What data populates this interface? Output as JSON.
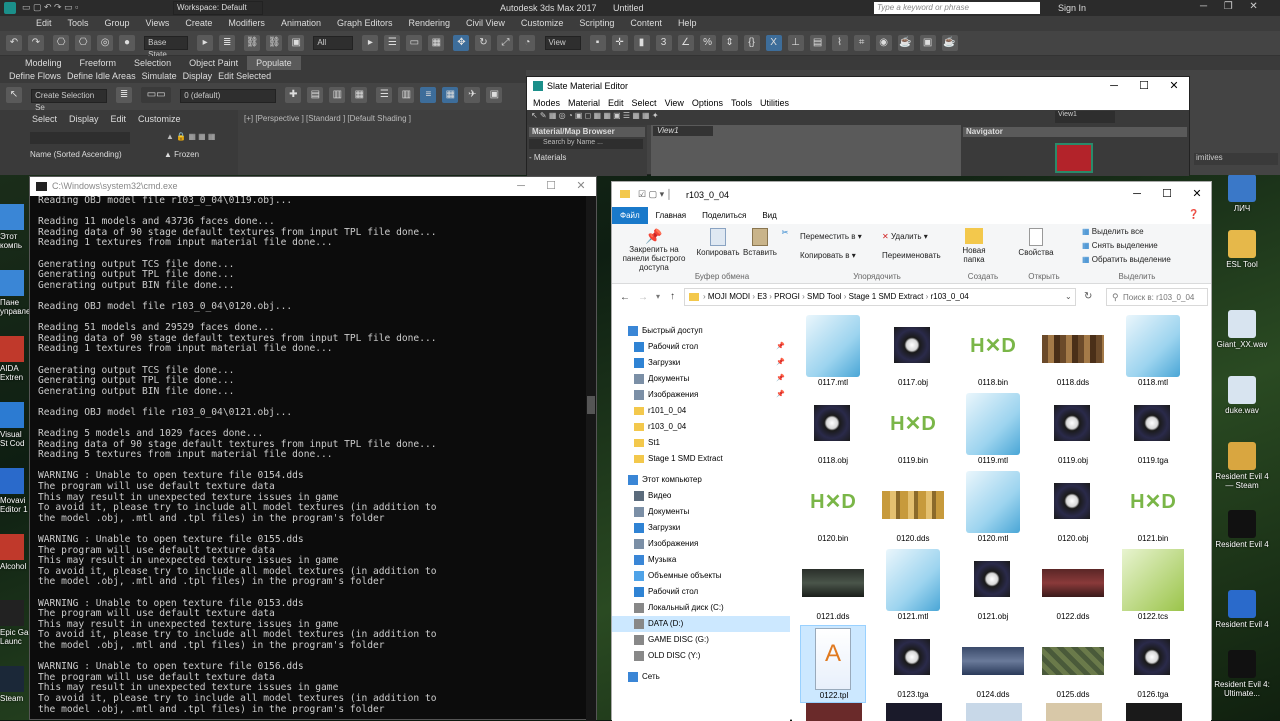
{
  "max": {
    "title": "Autodesk 3ds Max 2017",
    "file": "Untitled",
    "workspace": "Workspace: Default",
    "search_placeholder": "Type a keyword or phrase",
    "sign_in": "Sign In",
    "menu": [
      "Edit",
      "Tools",
      "Group",
      "Views",
      "Create",
      "Modifiers",
      "Animation",
      "Graph Editors",
      "Rendering",
      "Civil View",
      "Customize",
      "Scripting",
      "Content",
      "Help"
    ],
    "base_state": "Base State",
    "filter_all": "All",
    "view_combo": "View",
    "ribbon_tabs": [
      "Modeling",
      "Freeform",
      "Selection",
      "Object Paint",
      "Populate"
    ],
    "ribbon_items": [
      "Define Flows",
      "Define Idle Areas",
      "Simulate",
      "Display",
      "Edit Selected"
    ],
    "selection_set": "Create Selection Se",
    "layer": "0 (default)",
    "scene_tabs": [
      "Select",
      "Display",
      "Edit",
      "Customize"
    ],
    "scene_col_name": "Name (Sorted Ascending)",
    "scene_col_frozen": "▲ Frozen",
    "viewport_label": "[+] [Perspective ] [Standard ] [Default Shading ]",
    "right_panel_text": "imitives"
  },
  "slate": {
    "title": "Slate Material Editor",
    "menu": [
      "Modes",
      "Material",
      "Edit",
      "Select",
      "View",
      "Options",
      "Tools",
      "Utilities"
    ],
    "browser_title": "Material/Map Browser",
    "search_placeholder": "Search by Name ...",
    "materials_label": "- Materials",
    "view_tab": "View1",
    "view_combo": "View1",
    "navigator_title": "Navigator"
  },
  "cmd": {
    "title": "C:\\Windows\\system32\\cmd.exe",
    "lines": [
      "Reading OBJ model file r103_0_04\\0119.obj...",
      "",
      "Reading 11 models and 43736 faces done...",
      "Reading data of 90 stage default textures from input TPL file done...",
      "Reading 1 textures from input material file done...",
      "",
      "Generating output TCS file done...",
      "Generating output TPL file done...",
      "Generating output BIN file done...",
      "",
      "Reading OBJ model file r103_0_04\\0120.obj...",
      "",
      "Reading 51 models and 29529 faces done...",
      "Reading data of 90 stage default textures from input TPL file done...",
      "Reading 1 textures from input material file done...",
      "",
      "Generating output TCS file done...",
      "Generating output TPL file done...",
      "Generating output BIN file done...",
      "",
      "Reading OBJ model file r103_0_04\\0121.obj...",
      "",
      "Reading 5 models and 1029 faces done...",
      "Reading data of 90 stage default textures from input TPL file done...",
      "Reading 5 textures from input material file done...",
      "",
      "WARNING : Unable to open texture file 0154.dds",
      "The program will use default texture data",
      "This may result in unexpected texture issues in game",
      "To avoid it, please try to include all model textures (in addition to",
      "the model .obj, .mtl and .tpl files) in the program's folder",
      "",
      "WARNING : Unable to open texture file 0155.dds",
      "The program will use default texture data",
      "This may result in unexpected texture issues in game",
      "To avoid it, please try to include all model textures (in addition to",
      "the model .obj, .mtl and .tpl files) in the program's folder",
      "",
      "WARNING : Unable to open texture file 0153.dds",
      "The program will use default texture data",
      "This may result in unexpected texture issues in game",
      "To avoid it, please try to include all model textures (in addition to",
      "the model .obj, .mtl and .tpl files) in the program's folder",
      "",
      "WARNING : Unable to open texture file 0156.dds",
      "The program will use default texture data",
      "This may result in unexpected texture issues in game",
      "To avoid it, please try to include all model textures (in addition to",
      "the model .obj, .mtl and .tpl files) in the program's folder"
    ]
  },
  "explorer": {
    "title": "r103_0_04",
    "tabs": [
      "Файл",
      "Главная",
      "Поделиться",
      "Вид"
    ],
    "ribbon": {
      "pin": "Закрепить на панели быстрого доступа",
      "copy": "Копировать",
      "paste": "Вставить",
      "clipboard": "Буфер обмена",
      "move_to": "Переместить в ▾",
      "copy_to": "Копировать в ▾",
      "delete": "Удалить ▾",
      "rename": "Переименовать",
      "organize": "Упорядочить",
      "new_folder": "Новая папка",
      "create": "Создать",
      "properties": "Свойства",
      "open": "Открыть",
      "select_all": "Выделить все",
      "select_none": "Снять выделение",
      "invert": "Обратить выделение",
      "select": "Выделить"
    },
    "breadcrumb": [
      "MOJI MODI",
      "E3",
      "PROGI",
      "SMD Tool",
      "Stage 1 SMD Extract",
      "r103_0_04"
    ],
    "search_placeholder": "Поиск в: r103_0_04",
    "nav": [
      {
        "label": "Быстрый доступ",
        "indent": 0,
        "icon": "star-icon",
        "color": "#3a86d6"
      },
      {
        "label": "Рабочий стол",
        "indent": 1,
        "icon": "desktop-icon",
        "color": "#2f83d4"
      },
      {
        "label": "Загрузки",
        "indent": 1,
        "icon": "download-icon",
        "color": "#2f83d4"
      },
      {
        "label": "Документы",
        "indent": 1,
        "icon": "documents-icon",
        "color": "#7b8fa6"
      },
      {
        "label": "Изображения",
        "indent": 1,
        "icon": "pictures-icon",
        "color": "#7b8fa6"
      },
      {
        "label": "r101_0_04",
        "indent": 1,
        "icon": "folder-icon",
        "color": "#f3c84c"
      },
      {
        "label": "r103_0_04",
        "indent": 1,
        "icon": "folder-icon",
        "color": "#f3c84c"
      },
      {
        "label": "St1",
        "indent": 1,
        "icon": "folder-icon",
        "color": "#f3c84c"
      },
      {
        "label": "Stage 1 SMD Extract",
        "indent": 1,
        "icon": "folder-icon",
        "color": "#f3c84c"
      },
      {
        "label": "Этот компьютер",
        "indent": 0,
        "icon": "computer-icon",
        "color": "#3a86d6"
      },
      {
        "label": "Видео",
        "indent": 1,
        "icon": "video-icon",
        "color": "#5b6b7c"
      },
      {
        "label": "Документы",
        "indent": 1,
        "icon": "documents-icon",
        "color": "#7b8fa6"
      },
      {
        "label": "Загрузки",
        "indent": 1,
        "icon": "download-icon",
        "color": "#2f83d4"
      },
      {
        "label": "Изображения",
        "indent": 1,
        "icon": "pictures-icon",
        "color": "#7b8fa6"
      },
      {
        "label": "Музыка",
        "indent": 1,
        "icon": "music-icon",
        "color": "#3a86d6"
      },
      {
        "label": "Объемные объекты",
        "indent": 1,
        "icon": "3d-objects-icon",
        "color": "#4fa3e8"
      },
      {
        "label": "Рабочий стол",
        "indent": 1,
        "icon": "desktop-icon",
        "color": "#2f83d4"
      },
      {
        "label": "Локальный диск (C:)",
        "indent": 1,
        "icon": "drive-icon",
        "color": "#888888"
      },
      {
        "label": "DATA (D:)",
        "indent": 1,
        "icon": "drive-icon",
        "color": "#888888",
        "selected": true
      },
      {
        "label": "GAME DISC (G:)",
        "indent": 1,
        "icon": "drive-icon",
        "color": "#888888"
      },
      {
        "label": "OLD DISC (Y:)",
        "indent": 1,
        "icon": "drive-icon",
        "color": "#888888"
      },
      {
        "label": "Сеть",
        "indent": 0,
        "icon": "network-icon",
        "color": "#3a86d6"
      }
    ],
    "files": [
      {
        "name": "0117.mtl",
        "kind": "notepad"
      },
      {
        "name": "0117.obj",
        "kind": "emblem"
      },
      {
        "name": "0118.bin",
        "kind": "hxd"
      },
      {
        "name": "0118.dds",
        "kind": "tex-brown"
      },
      {
        "name": "0118.mtl",
        "kind": "notepad"
      },
      {
        "name": "0118.obj",
        "kind": "emblem"
      },
      {
        "name": "0119.bin",
        "kind": "hxd"
      },
      {
        "name": "0119.mtl",
        "kind": "notepad"
      },
      {
        "name": "0119.obj",
        "kind": "emblem"
      },
      {
        "name": "0119.tga",
        "kind": "emblem"
      },
      {
        "name": "0120.bin",
        "kind": "hxd"
      },
      {
        "name": "0120.dds",
        "kind": "tex-yellow"
      },
      {
        "name": "0120.mtl",
        "kind": "notepad"
      },
      {
        "name": "0120.obj",
        "kind": "emblem"
      },
      {
        "name": "0121.bin",
        "kind": "hxd"
      },
      {
        "name": "0121.dds",
        "kind": "tex-dark"
      },
      {
        "name": "0121.mtl",
        "kind": "notepad"
      },
      {
        "name": "0121.obj",
        "kind": "emblem"
      },
      {
        "name": "0122.dds",
        "kind": "tex-red"
      },
      {
        "name": "0122.tcs",
        "kind": "notepadpp"
      },
      {
        "name": "0122.tpl",
        "kind": "tpl",
        "selected": true
      },
      {
        "name": "0123.tga",
        "kind": "emblem"
      },
      {
        "name": "0124.dds",
        "kind": "tex-blue"
      },
      {
        "name": "0125.dds",
        "kind": "tex-green"
      },
      {
        "name": "0126.tga",
        "kind": "emblem"
      }
    ]
  },
  "desktop": {
    "left_icons": [
      "Этот компь",
      "Пане управле",
      "AIDA Extren",
      "Visual St Cod",
      "Movavi Editor 1",
      "Alcohol",
      "Epic Ga Launc",
      "Steam"
    ],
    "right_icons": [
      "ЛИЧ",
      "ESL Tool",
      "Giant_XX.wav",
      "duke.wav",
      "Resident Evil 4 — Steam",
      "Resident Evil 4",
      "Resident Evil 4",
      "Resident Evil 4: Ultimate..."
    ]
  }
}
